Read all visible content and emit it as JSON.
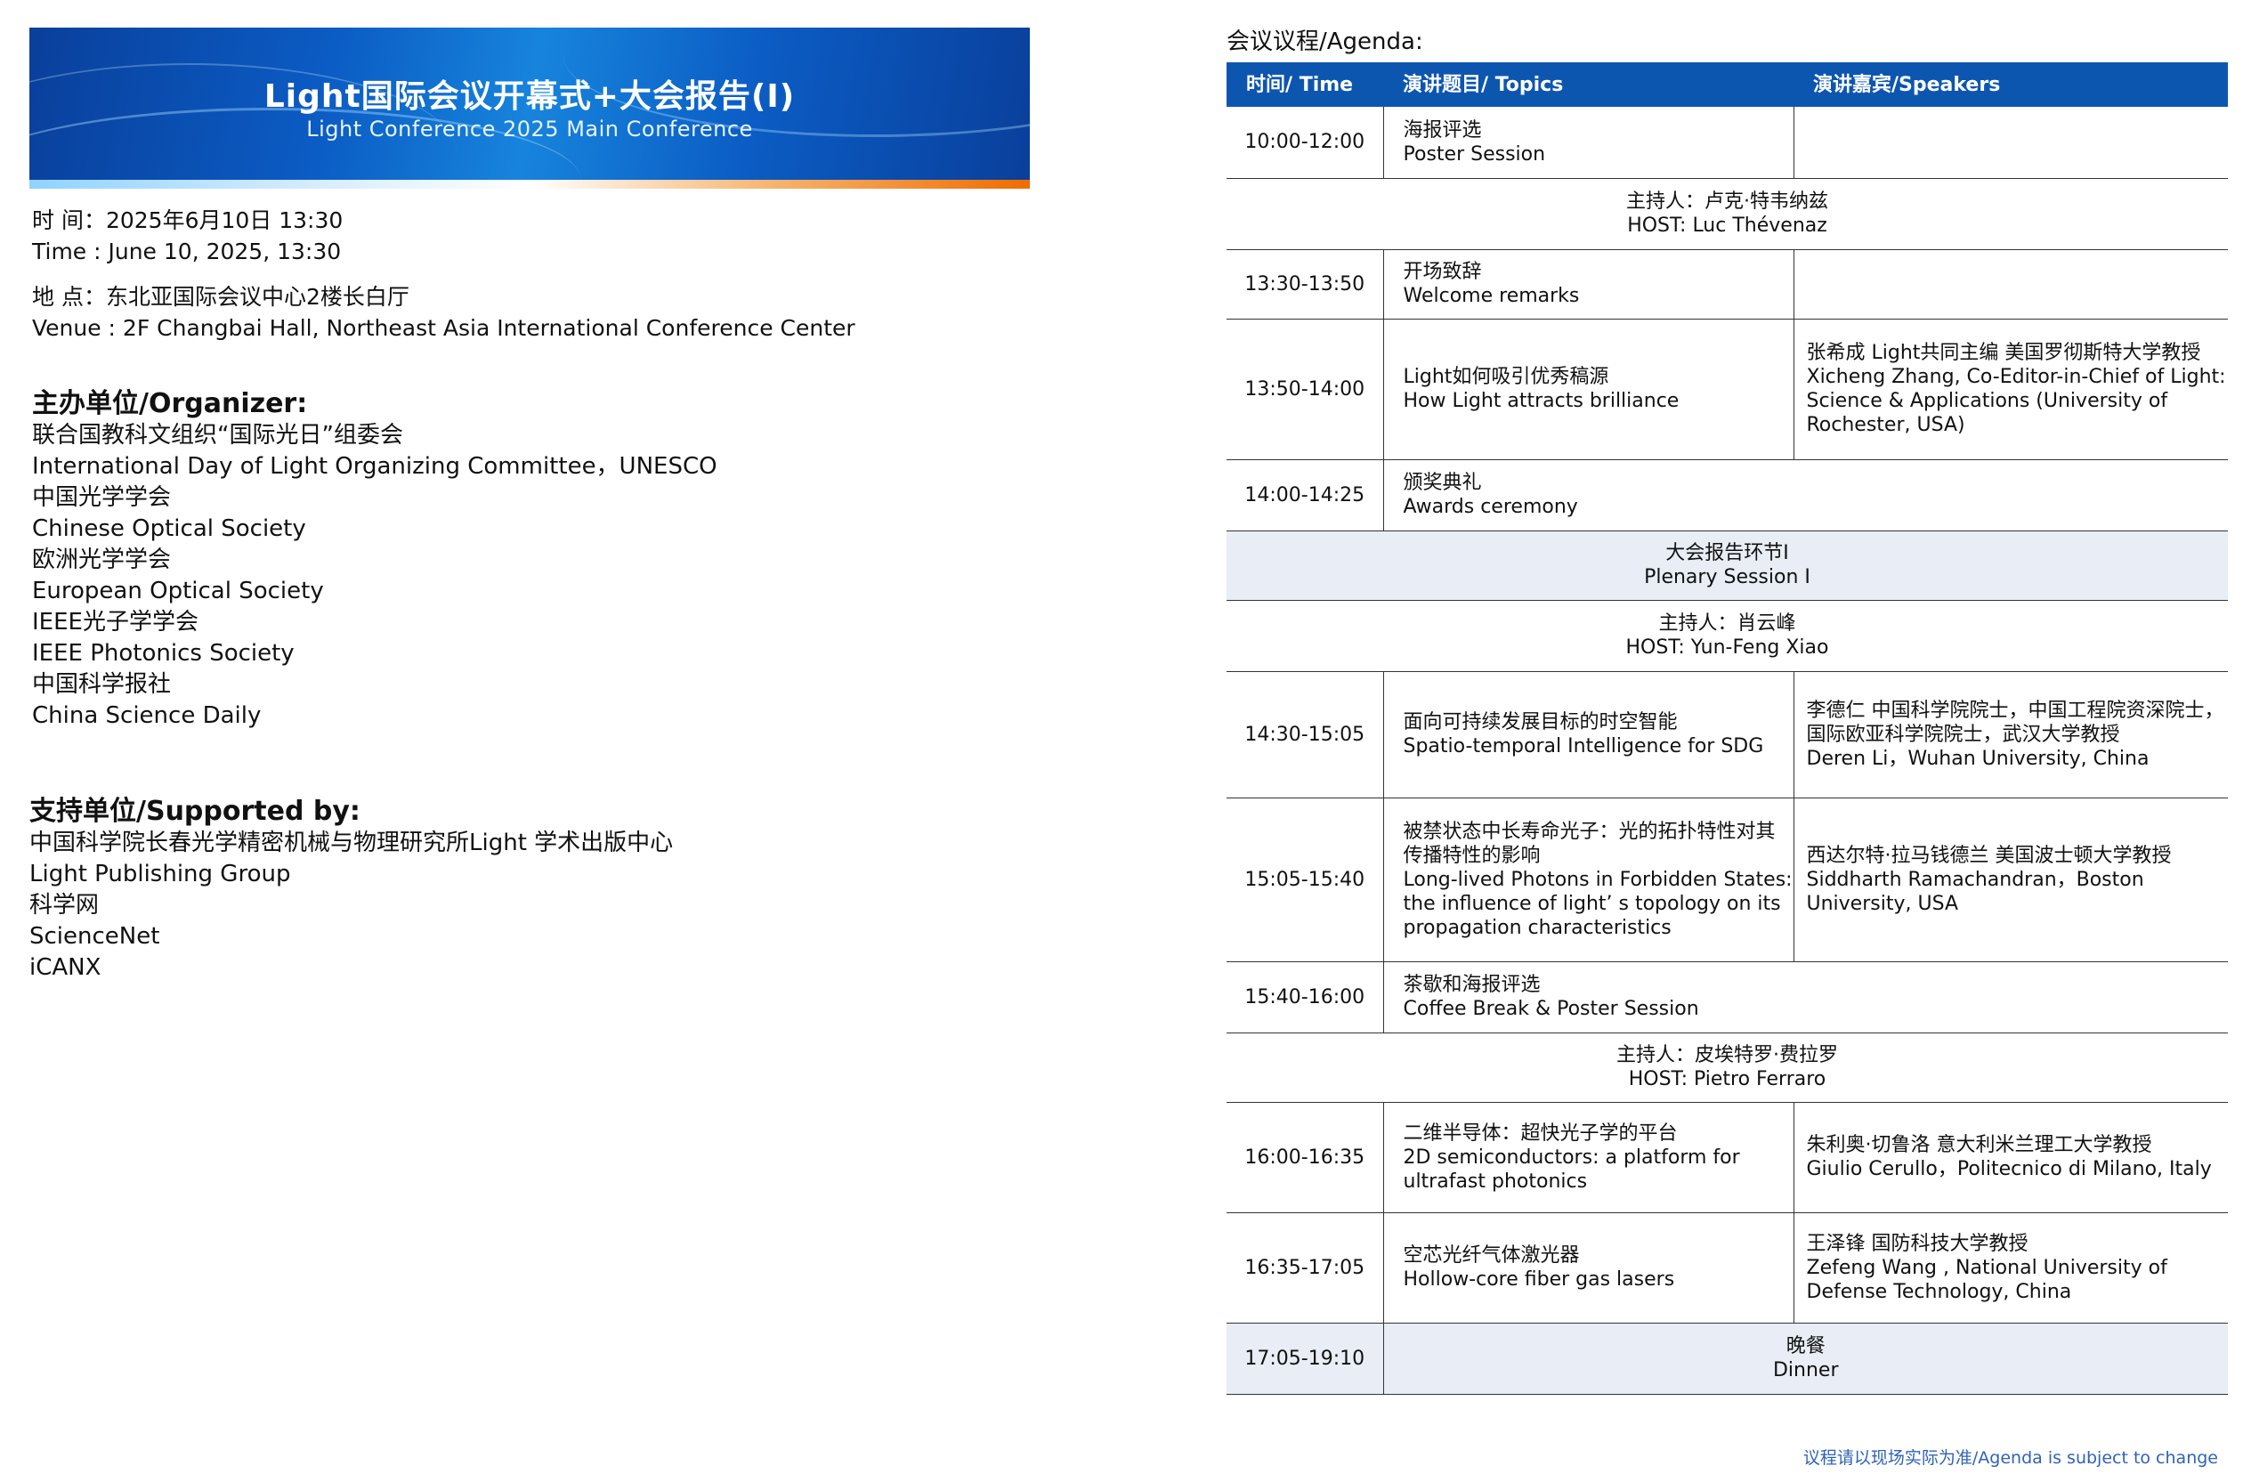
{
  "banner": {
    "title": "Light国际会议开幕式+大会报告(I)",
    "subtitle": "Light Conference 2025 Main Conference"
  },
  "info": {
    "time_cn": "时 间：2025年6月10日 13:30",
    "time_en": "Time : June 10, 2025, 13:30",
    "venue_cn": "地 点：东北亚国际会议中心2楼长白厅",
    "venue_en": "Venue : 2F Changbai Hall, Northeast Asia International Conference Center"
  },
  "organizer": {
    "title": "主办单位/Organizer:",
    "items": [
      "联合国教科文组织“国际光日”组委会",
      "International Day of Light Organizing Committee，UNESCO",
      "中国光学学会",
      "Chinese Optical Society",
      "欧洲光学学会",
      "European Optical Society",
      "IEEE光子学学会",
      "IEEE Photonics Society",
      "中国科学报社",
      "China Science Daily"
    ]
  },
  "supporter": {
    "title": "支持单位/Supported by:",
    "items": [
      "中国科学院长春光学精密机械与物理研究所Light 学术出版中心",
      "Light Publishing Group",
      "科学网",
      "ScienceNet",
      "iCANX"
    ]
  },
  "agenda": {
    "label": "会议议程/Agenda:",
    "headers": [
      "时间/ Time",
      "演讲题目/ Topics",
      "演讲嘉宾/Speakers"
    ],
    "rows": {
      "r1": {
        "time": "10:00-12:00",
        "topic_cn": "海报评选",
        "topic_en": "Poster Session"
      },
      "h1": {
        "cn": "主持人：卢克·特韦纳兹",
        "en": "HOST: Luc Thévenaz"
      },
      "r2": {
        "time": "13:30-13:50",
        "topic_cn": "开场致辞",
        "topic_en": "Welcome remarks"
      },
      "r3": {
        "time": "13:50-14:00",
        "topic_cn": "Light如何吸引优秀稿源",
        "topic_en": "How Light attracts brilliance",
        "spk_cn": "张希成 Light共同主编 美国罗彻斯特大学教授",
        "spk_en": "Xicheng Zhang, Co-Editor-in-Chief of Light: Science & Applications (University of Rochester, USA)"
      },
      "r4": {
        "time": "14:00-14:25",
        "topic_cn": "颁奖典礼",
        "topic_en": "Awards ceremony"
      },
      "s1": {
        "cn": "大会报告环节I",
        "en": "Plenary Session I"
      },
      "h2": {
        "cn": "主持人：肖云峰",
        "en": "HOST:  Yun-Feng Xiao"
      },
      "r5": {
        "time": "14:30-15:05",
        "topic_cn": "面向可持续发展目标的时空智能",
        "topic_en": "Spatio-temporal Intelligence for SDG",
        "spk_cn": "李德仁 中国科学院院士，中国工程院资深院士，国际欧亚科学院院士，武汉大学教授",
        "spk_en": "Deren Li，Wuhan University, China"
      },
      "r6": {
        "time": "15:05-15:40",
        "topic_cn": "被禁状态中长寿命光子：光的拓扑特性对其传播特性的影响",
        "topic_en": "Long-lived Photons in Forbidden States: the influence of light’ s topology on its propagation characteristics",
        "spk_cn": "西达尔特·拉马钱德兰 美国波士顿大学教授",
        "spk_en": "Siddharth Ramachandran，Boston University, USA"
      },
      "r7": {
        "time": "15:40-16:00",
        "topic_cn": "茶歇和海报评选",
        "topic_en": "Coffee Break & Poster Session"
      },
      "h3": {
        "cn": "主持人：皮埃特罗·费拉罗",
        "en": "HOST: Pietro Ferraro"
      },
      "r8": {
        "time": "16:00-16:35",
        "topic_cn": "二维半导体：超快光子学的平台",
        "topic_en": "2D semiconductors: a platform for ultrafast photonics",
        "spk_cn": "朱利奥·切鲁洛 意大利米兰理工大学教授",
        "spk_en": "Giulio Cerullo，Politecnico di Milano, Italy"
      },
      "r9": {
        "time": "16:35-17:05",
        "topic_cn": "空芯光纤气体激光器",
        "topic_en": "Hollow-core fiber gas lasers",
        "spk_cn": "王泽锋 国防科技大学教授",
        "spk_en": "Zefeng Wang , National University of Defense Technology, China"
      },
      "r10": {
        "time": "17:05-19:10",
        "cn": "晚餐",
        "en": "Dinner"
      }
    },
    "note": "议程请以现场实际为准/Agenda is subject to change"
  },
  "colors": {
    "header_blue": "#0d56b0",
    "shade": "#e9edf6",
    "note_blue": "#2f63b8"
  }
}
